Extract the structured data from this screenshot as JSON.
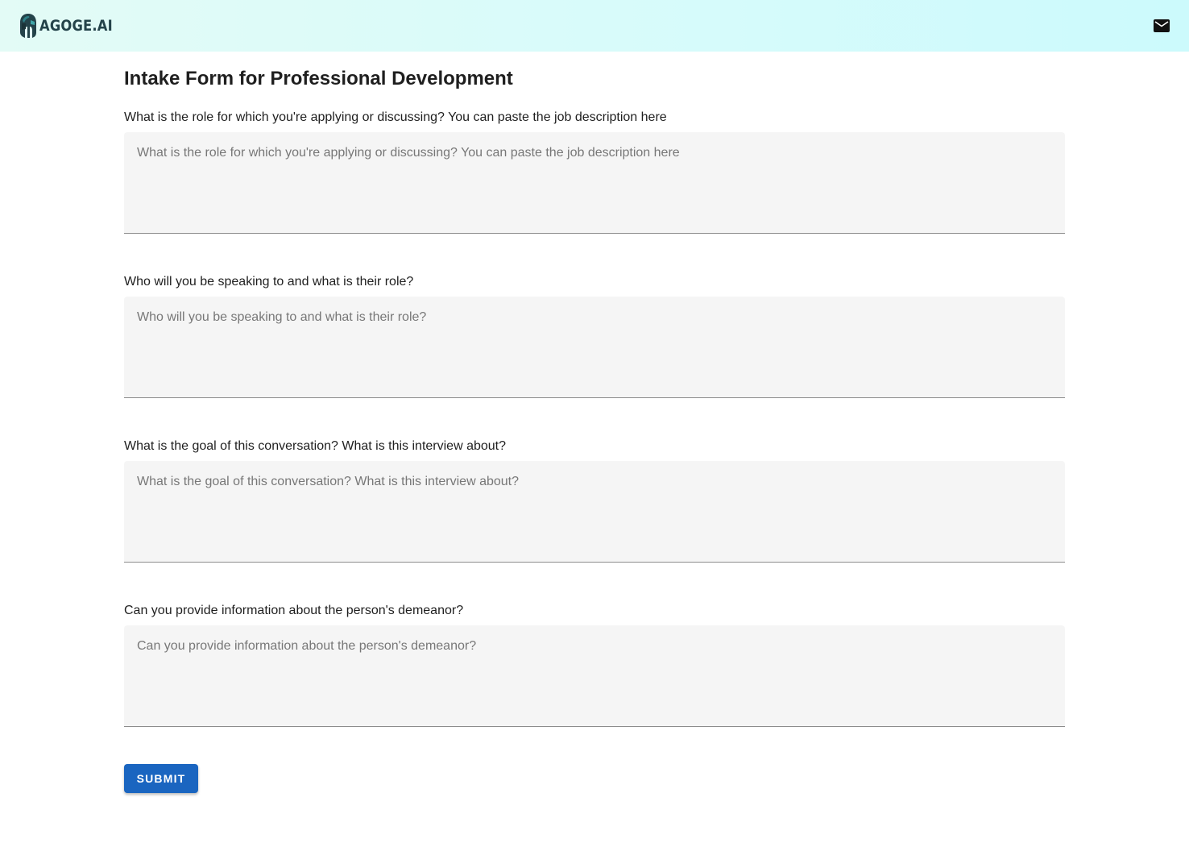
{
  "header": {
    "brand": "AGOGE.AI",
    "logo_icon": "spartan-helmet-icon",
    "mail_icon": "mail-icon"
  },
  "page": {
    "title": "Intake Form for Professional Development"
  },
  "form": {
    "questions": [
      {
        "label": "What is the role for which you're applying or discussing? You can paste the job description here",
        "placeholder": "What is the role for which you're applying or discussing? You can paste the job description here",
        "value": ""
      },
      {
        "label": "Who will you be speaking to and what is their role?",
        "placeholder": "Who will you be speaking to and what is their role?",
        "value": ""
      },
      {
        "label": "What is the goal of this conversation? What is this interview about?",
        "placeholder": "What is the goal of this conversation? What is this interview about?",
        "value": ""
      },
      {
        "label": "Can you provide information about the person's demeanor?",
        "placeholder": "Can you provide information about the person's demeanor?",
        "value": ""
      }
    ],
    "submit_label": "SUBMIT"
  },
  "colors": {
    "header_gradient_start": "#e3fbf6",
    "header_gradient_end": "#ccfafc",
    "field_background": "#f5f5f5",
    "submit_button": "#1a65c0",
    "brand_text": "#24434a"
  }
}
